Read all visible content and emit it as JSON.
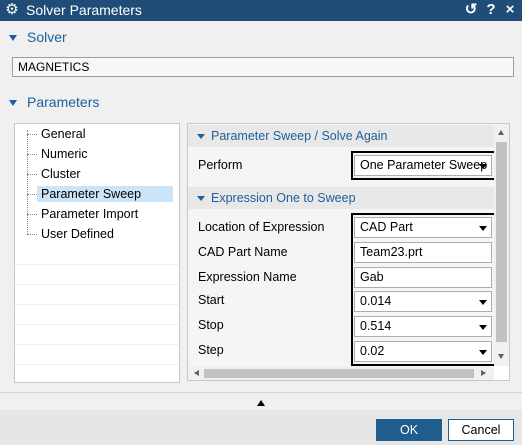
{
  "window": {
    "title": "Solver Parameters",
    "icons": {
      "app": "gear-icon",
      "reset": "reset-icon",
      "help": "help-icon",
      "close": "close-icon"
    },
    "help_glyph": "?",
    "close_glyph": "×",
    "reset_glyph": "↺",
    "app_glyph": "⚙"
  },
  "solver": {
    "heading": "Solver",
    "value": "MAGNETICS"
  },
  "parameters": {
    "heading": "Parameters",
    "tree": [
      {
        "label": "General",
        "selected": false
      },
      {
        "label": "Numeric",
        "selected": false
      },
      {
        "label": "Cluster",
        "selected": false
      },
      {
        "label": "Parameter Sweep",
        "selected": true
      },
      {
        "label": "Parameter Import",
        "selected": false
      },
      {
        "label": "User Defined",
        "selected": false
      }
    ]
  },
  "sweep": {
    "heading": "Parameter Sweep / Solve Again",
    "perform_label": "Perform",
    "perform_value": "One Parameter Sweep"
  },
  "expression": {
    "heading": "Expression One to Sweep",
    "rows": [
      {
        "label": "Location of Expression",
        "value": "CAD Part",
        "dropdown": true
      },
      {
        "label": "CAD Part Name",
        "value": "Team23.prt",
        "dropdown": false
      },
      {
        "label": "Expression Name",
        "value": "Gab",
        "dropdown": false
      },
      {
        "label": "Start",
        "value": "0.014",
        "dropdown": true
      },
      {
        "label": "Stop",
        "value": "0.514",
        "dropdown": true
      },
      {
        "label": "Step",
        "value": "0.02",
        "dropdown": true
      }
    ]
  },
  "footer": {
    "ok_label": "OK",
    "cancel_label": "Cancel"
  },
  "colors": {
    "titlebar": "#1f4d78",
    "accent": "#1c5f9c",
    "primary_button": "#1f5d8f",
    "selection": "#cce4f7"
  }
}
